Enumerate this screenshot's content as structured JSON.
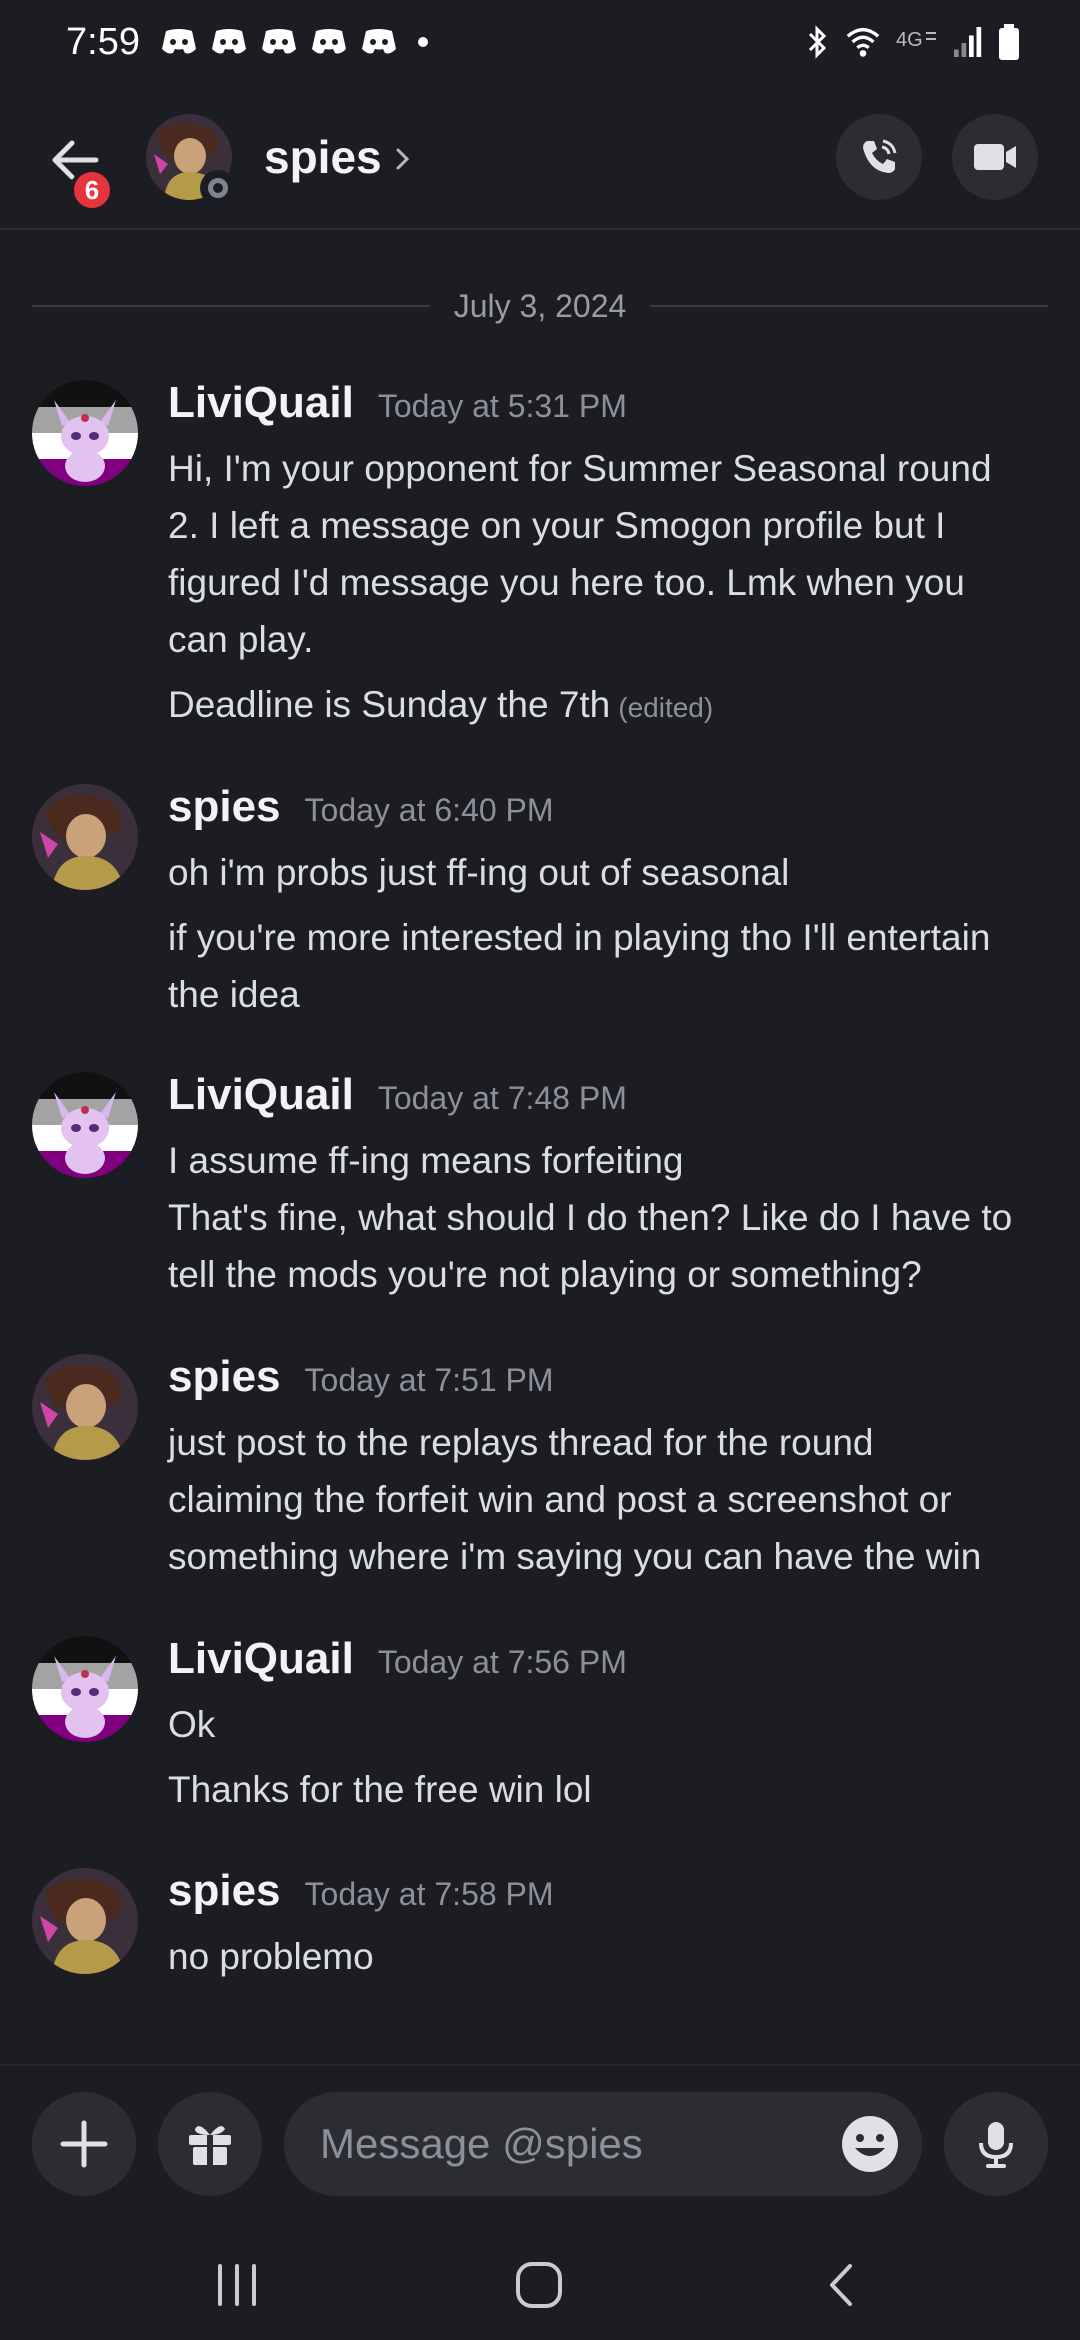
{
  "status_bar": {
    "time": "7:59",
    "network": "4G"
  },
  "header": {
    "unread_badge": "6",
    "contact_name": "spies"
  },
  "date_divider": "July 3, 2024",
  "messages": [
    {
      "author": "LiviQuail",
      "time": "Today at 5:31 PM",
      "lines": [
        "Hi, I'm your opponent for Summer Seasonal round",
        "2. I left a message on your Smogon profile but I",
        "figured I'd message you here too. Lmk when you",
        "can play."
      ],
      "line2": "Deadline is Sunday the 7th",
      "edited": "(edited)"
    },
    {
      "author": "spies",
      "time": "Today at 6:40 PM",
      "lines": [
        "oh i'm probs just ff-ing out of seasonal"
      ],
      "line2a": "if you're more interested in playing tho I'll entertain",
      "line2b": "the idea"
    },
    {
      "author": "LiviQuail",
      "time": "Today at 7:48 PM",
      "lines": [
        "I assume ff-ing means forfeiting",
        "That's fine, what should I do then? Like do I have to",
        "tell the mods you're not playing or something?"
      ]
    },
    {
      "author": "spies",
      "time": "Today at 7:51 PM",
      "lines": [
        "just post to the replays thread for the round",
        "claiming the forfeit win and post a screenshot or",
        "something where i'm saying you can have the win"
      ]
    },
    {
      "author": "LiviQuail",
      "time": "Today at 7:56 PM",
      "lines": [
        "Ok"
      ],
      "line2": "Thanks for the free win lol"
    },
    {
      "author": "spies",
      "time": "Today at 7:58 PM",
      "lines": [
        "no problemo"
      ]
    }
  ],
  "composer": {
    "placeholder": "Message @spies"
  },
  "colors": {
    "background": "#1c1d23",
    "badge": "#e5343d",
    "button_bg": "#2b2d33"
  },
  "icons": [
    "back-arrow-icon",
    "chevron-right-icon",
    "phone-call-icon",
    "video-camera-icon",
    "plus-icon",
    "gift-icon",
    "emoji-icon",
    "microphone-icon"
  ]
}
